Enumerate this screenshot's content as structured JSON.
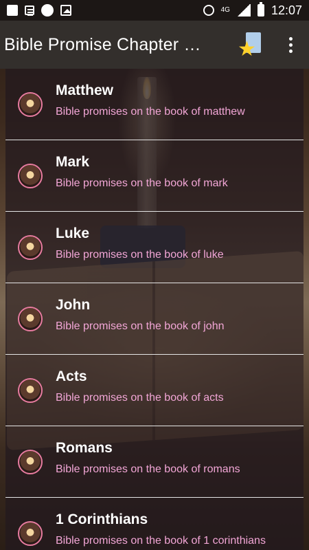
{
  "statusbar": {
    "time": "12:07",
    "network": "4G",
    "icons": [
      "notification-icon",
      "news-icon",
      "circle-icon",
      "gallery-icon",
      "data-saver-icon",
      "signal-icon",
      "battery-icon"
    ]
  },
  "appbar": {
    "title": "Bible Promise Chapter by…",
    "favorite_icon": "favorite-star-doc-icon",
    "menu_icon": "overflow-menu-icon"
  },
  "list": {
    "items": [
      {
        "title": "Matthew",
        "subtitle": "Bible promises on the book of matthew"
      },
      {
        "title": "Mark",
        "subtitle": "Bible promises on the book of mark"
      },
      {
        "title": "Luke",
        "subtitle": "Bible promises on the book of luke"
      },
      {
        "title": "John",
        "subtitle": "Bible promises on the book of john"
      },
      {
        "title": "Acts",
        "subtitle": "Bible promises on the book of acts"
      },
      {
        "title": "Romans",
        "subtitle": "Bible promises on the book of romans"
      },
      {
        "title": "1 Corinthians",
        "subtitle": "Bible promises on the book of 1 corinthians"
      }
    ]
  },
  "colors": {
    "appbar": "#332f2c",
    "title": "#ffffff",
    "subtitle": "#f2a6d6",
    "divider": "#e6e6e6"
  }
}
